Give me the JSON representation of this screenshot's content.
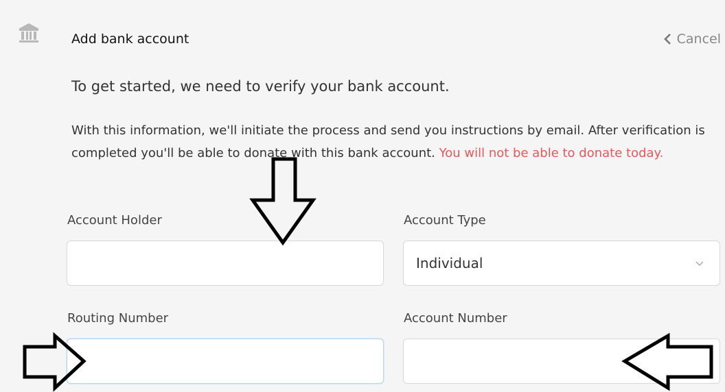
{
  "header": {
    "icon": "bank-icon",
    "title": "Add bank account",
    "cancel_label": "Cancel",
    "cancel_icon": "chevron-left-icon"
  },
  "intro": "To get started, we need to verify your bank account.",
  "description": {
    "text": "With this information, we'll initiate the process and send you instructions by email. After verification is completed you'll be able to donate with this bank account.",
    "warning": "You will not be able to donate today.",
    "warning_color": "#e8585a"
  },
  "form": {
    "account_holder": {
      "label": "Account Holder",
      "value": ""
    },
    "account_type": {
      "label": "Account Type",
      "value": "Individual",
      "icon": "chevron-down-icon"
    },
    "routing_number": {
      "label": "Routing Number",
      "value": ""
    },
    "account_number": {
      "label": "Account Number",
      "value": ""
    }
  },
  "annotations": {
    "arrow_icons": [
      "arrow-down-icon",
      "arrow-right-icon",
      "arrow-left-icon"
    ],
    "stroke_color": "#000000"
  }
}
